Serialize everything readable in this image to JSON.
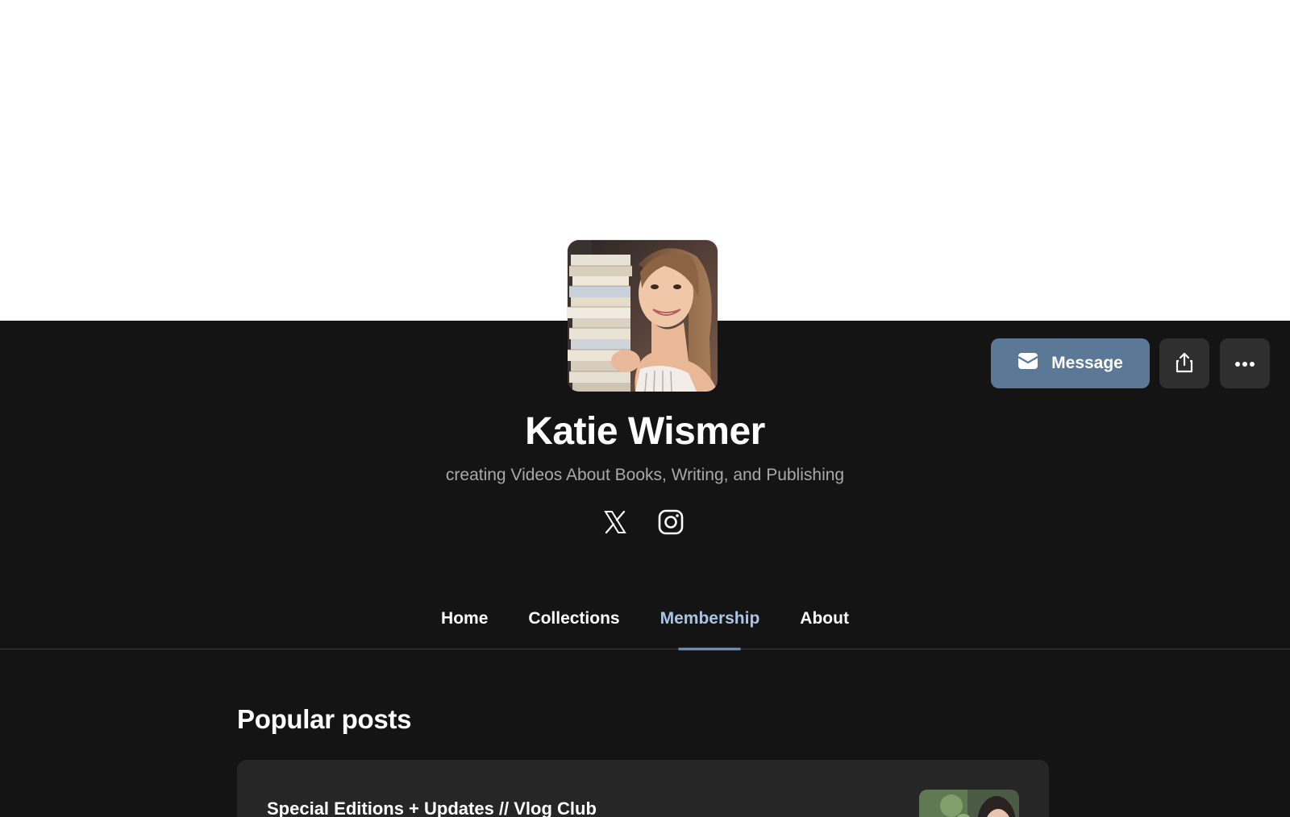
{
  "profile": {
    "name": "Katie Wismer",
    "tagline": "creating Videos About Books, Writing, and Publishing",
    "avatar_icon": "profile-photo"
  },
  "actions": {
    "message_label": "Message",
    "message_icon": "envelope-icon",
    "share_icon": "share-icon",
    "more_icon": "more-horizontal-icon"
  },
  "social": [
    {
      "icon": "x-twitter-icon"
    },
    {
      "icon": "instagram-icon"
    }
  ],
  "tabs": [
    {
      "label": "Home",
      "active": false
    },
    {
      "label": "Collections",
      "active": false
    },
    {
      "label": "Membership",
      "active": true
    },
    {
      "label": "About",
      "active": false
    }
  ],
  "popular": {
    "title": "Popular posts",
    "posts": [
      {
        "title": "Special Editions + Updates // Vlog Club"
      }
    ]
  },
  "colors": {
    "background": "#141414",
    "accent": "#a9c4e4",
    "message_button": "#5b7896",
    "card": "#262626"
  }
}
